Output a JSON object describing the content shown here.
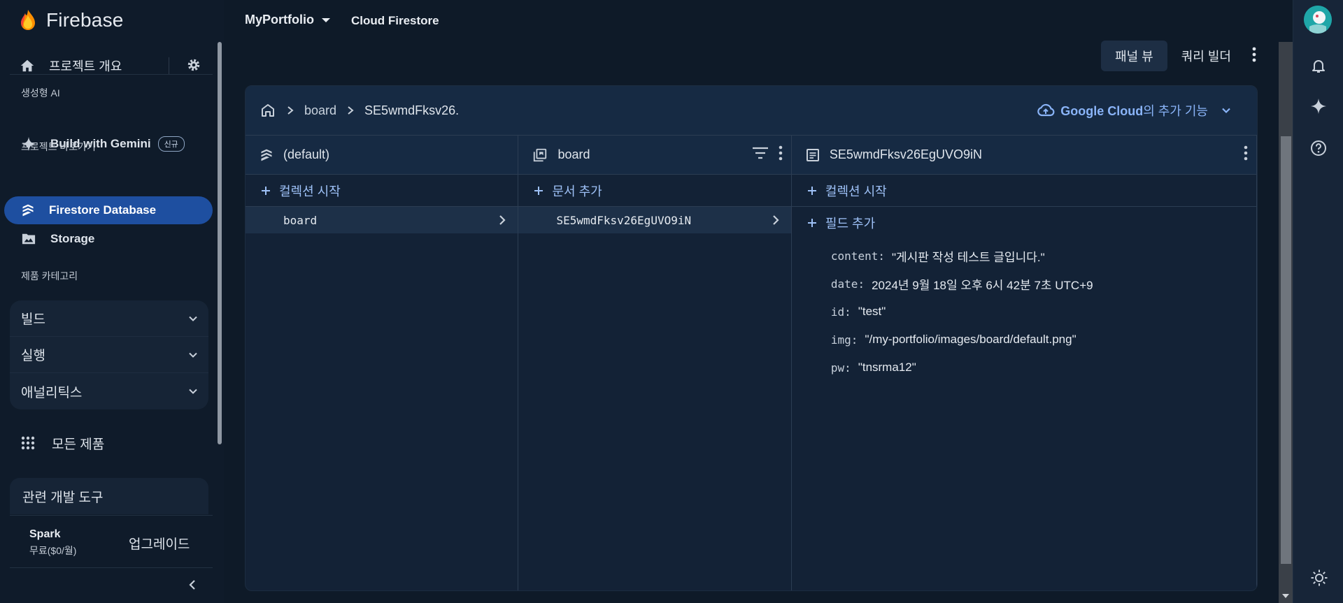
{
  "brand": {
    "name": "Firebase"
  },
  "sidebar": {
    "overview_label": "프로젝트 개요",
    "section_genai": "생성형 AI",
    "gemini_label": "Build with Gemini",
    "gemini_badge": "신규",
    "section_shortcuts": "프로젝트 바로가기",
    "firestore_label": "Firestore Database",
    "storage_label": "Storage",
    "section_categories": "제품 카테고리",
    "categories": [
      {
        "label": "빌드"
      },
      {
        "label": "실행"
      },
      {
        "label": "애널리틱스"
      }
    ],
    "all_products": "모든 제품",
    "dev_tools": "관련 개발 도구",
    "plan_name": "Spark",
    "plan_price": "무료($0/월)",
    "upgrade": "업그레이드"
  },
  "topbar": {
    "project": "MyPortfolio",
    "product": "Cloud Firestore"
  },
  "view": {
    "panel_view": "패널 뷰",
    "query_builder": "쿼리 빌더"
  },
  "breadcrumb": {
    "collection": "board",
    "document": "SE5wmdFksv26."
  },
  "gcloud": {
    "brand": "Google Cloud",
    "suffix": "의 추가 기능"
  },
  "columns": {
    "root": {
      "title": "(default)",
      "add_label": "컬렉션 시작",
      "items": [
        "board"
      ]
    },
    "collection": {
      "title": "board",
      "add_label": "문서 추가",
      "items": [
        "SE5wmdFksv26EgUVO9iN"
      ]
    },
    "document": {
      "title": "SE5wmdFksv26EgUVO9iN",
      "add_collection": "컬렉션 시작",
      "add_field": "필드 추가",
      "fields": [
        {
          "key": "content:",
          "value": "\"게시판 작성 테스트 글입니다.\""
        },
        {
          "key": "date:",
          "value": "2024년 9월 18일 오후 6시 42분 7초 UTC+9"
        },
        {
          "key": "id:",
          "value": "\"test\""
        },
        {
          "key": "img:",
          "value": "\"/my-portfolio/images/board/default.png\""
        },
        {
          "key": "pw:",
          "value": "\"tnsrma12\""
        }
      ]
    }
  },
  "colors": {
    "accent": "#1e4fa0",
    "link": "#8ab4f8",
    "background": "#0e1a28"
  }
}
